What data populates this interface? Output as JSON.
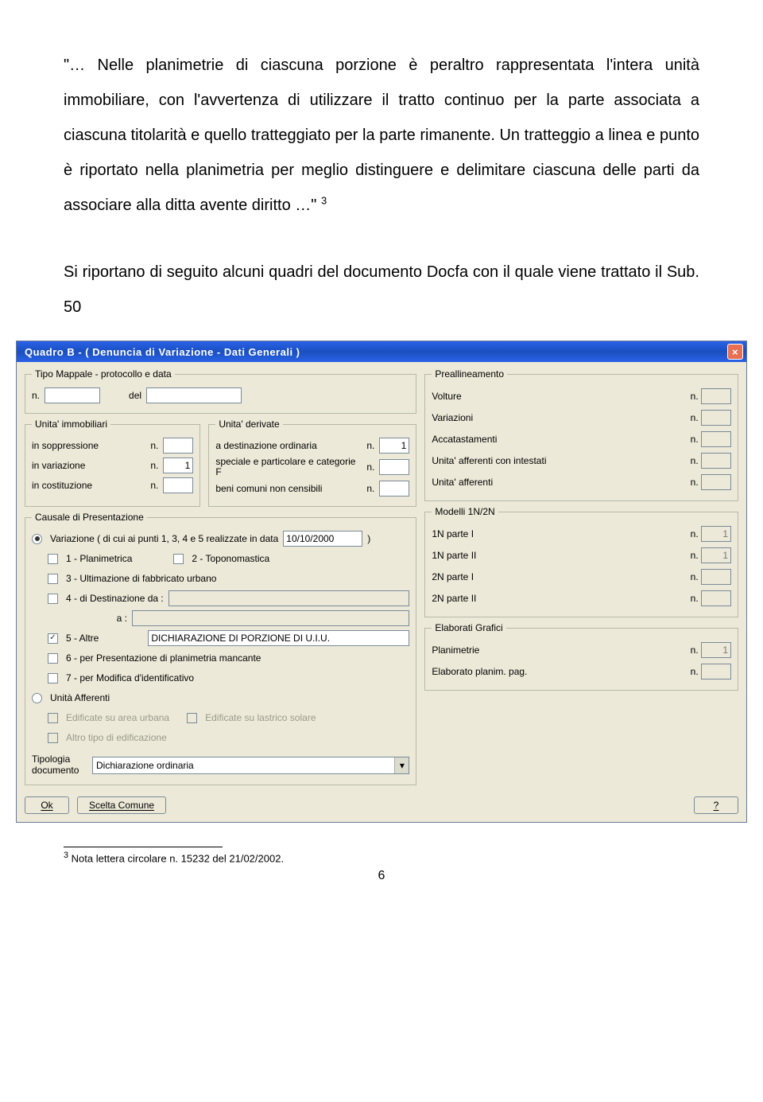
{
  "doc": {
    "para1": "\"… Nelle planimetrie di ciascuna porzione è peraltro rappresentata l'intera unità immobiliare, con l'avvertenza di utilizzare il tratto continuo per la parte associata a ciascuna titolarità e quello tratteggiato per la parte rimanente. Un tratteggio a linea e punto è riportato nella planimetria per meglio distinguere e delimitare ciascuna delle parti da associare alla ditta avente diritto …\"",
    "sup": "3",
    "para2": "Si riportano di seguito alcuni quadri del documento Docfa con il quale viene trattato il Sub. 50",
    "footnote": "Nota lettera circolare n. 15232 del 21/02/2002.",
    "pagenum": "6"
  },
  "window": {
    "title": "Quadro B - ( Denuncia di Variazione - Dati Generali )",
    "tipo_mappale": {
      "legend": "Tipo Mappale - protocollo e data",
      "n_label": "n.",
      "n_value": "",
      "del_label": "del",
      "del_value": ""
    },
    "unita_imm": {
      "legend": "Unita' immobiliari",
      "rows": [
        {
          "label": "in soppressione",
          "value": ""
        },
        {
          "label": "in variazione",
          "value": "1"
        },
        {
          "label": "in costituzione",
          "value": ""
        }
      ],
      "n_label": "n."
    },
    "unita_der": {
      "legend": "Unita' derivate",
      "rows": [
        {
          "label": "a destinazione ordinaria",
          "value": "1"
        },
        {
          "label": "speciale e particolare e categorie F",
          "value": ""
        },
        {
          "label": "beni comuni non censibili",
          "value": ""
        }
      ],
      "n_label": "n."
    },
    "causale": {
      "legend": "Causale di Presentazione",
      "variazione_label": "Variazione ( di cui ai punti 1, 3, 4 e 5 realizzate in data",
      "variazione_date": "10/10/2000",
      "close_paren": ")",
      "c1": "1 - Planimetrica",
      "c2": "2 - Toponomastica",
      "c3": "3 - Ultimazione di fabbricato urbano",
      "c4": "4 - di Destinazione da :",
      "c4a_label": "a :",
      "c4_from": "",
      "c4_to": "",
      "c5": "5 - Altre",
      "c5_value": "DICHIARAZIONE DI PORZIONE DI U.I.U.",
      "c6": "6 - per Presentazione di planimetria mancante",
      "c7": "7 - per Modifica d'identificativo",
      "unita_aff": "Unità Afferenti",
      "edif_urb": "Edificate su area urbana",
      "edif_sol": "Edificate su lastrico solare",
      "altro_edif": "Altro tipo di edificazione",
      "tip_doc_label": "Tipologia documento",
      "tip_doc_value": "Dichiarazione ordinaria"
    },
    "preall": {
      "legend": "Preallineamento",
      "rows": [
        {
          "label": "Volture",
          "value": ""
        },
        {
          "label": "Variazioni",
          "value": ""
        },
        {
          "label": "Accatastamenti",
          "value": ""
        },
        {
          "label": "Unita' afferenti con intestati",
          "value": ""
        },
        {
          "label": "Unita' afferenti",
          "value": ""
        }
      ],
      "n_label": "n."
    },
    "modelli": {
      "legend": "Modelli 1N/2N",
      "rows": [
        {
          "label": "1N parte I",
          "value": "1"
        },
        {
          "label": "1N parte II",
          "value": "1"
        },
        {
          "label": "2N parte I",
          "value": ""
        },
        {
          "label": "2N parte II",
          "value": ""
        }
      ],
      "n_label": "n."
    },
    "elab": {
      "legend": "Elaborati Grafici",
      "rows": [
        {
          "label": "Planimetrie",
          "value": "1"
        },
        {
          "label": "Elaborato planim. pag.",
          "value": ""
        }
      ],
      "n_label": "n."
    },
    "buttons": {
      "ok": "Ok",
      "scelta": "Scelta Comune",
      "help": "?"
    }
  }
}
